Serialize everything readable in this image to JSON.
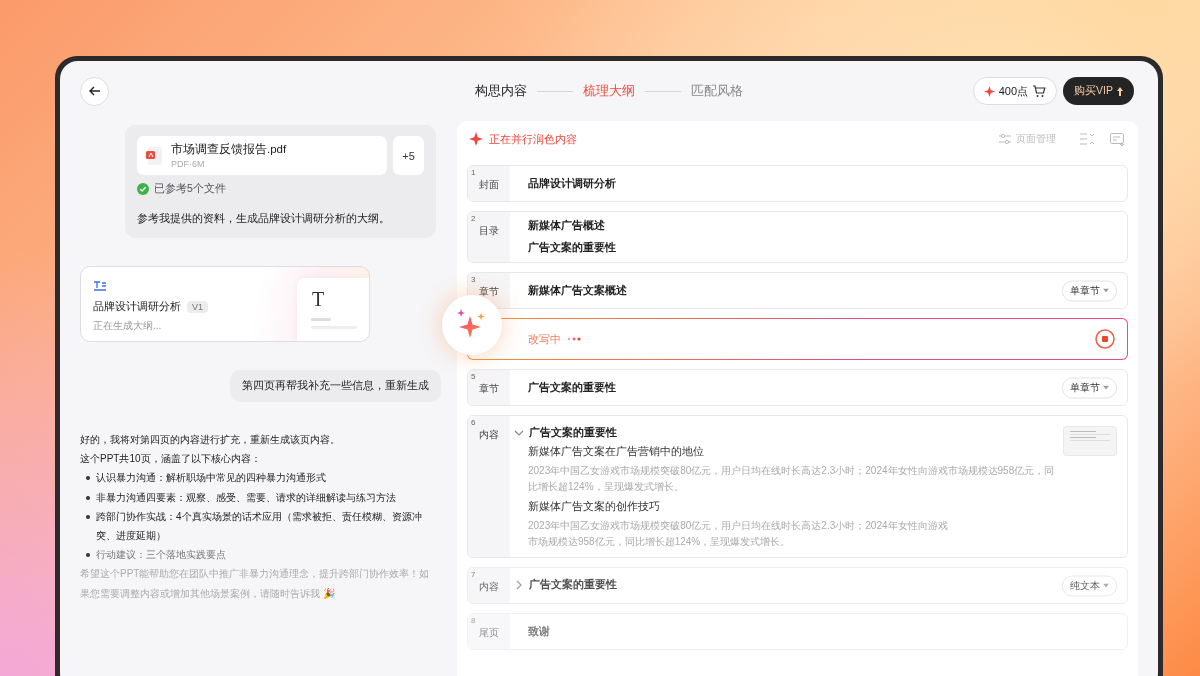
{
  "steps": [
    {
      "label": "构思内容",
      "selected": false,
      "done": true
    },
    {
      "label": "梳理大纲",
      "selected": true,
      "done": false
    },
    {
      "label": "匹配风格",
      "selected": false,
      "done": false
    }
  ],
  "points": "400点",
  "vip_button": "购买VIP",
  "chat": {
    "file": {
      "name": "市场调查反馈报告.pdf",
      "meta": "PDF·6M"
    },
    "more_files": "+5",
    "referenced": "已参考5个文件",
    "prompt": "参考我提供的资料，生成品牌设计调研分析的大纲。",
    "outline_card": {
      "title": "品牌设计调研分析",
      "version": "V1",
      "status": "正在生成大纲...",
      "preview_letter": "T"
    },
    "followup": "第四页再帮我补充一些信息，重新生成",
    "reply": {
      "lines": [
        "好的，我将对第四页的内容进行扩充，重新生成该页内容。",
        "这个PPT共10页，涵盖了以下核心内容："
      ],
      "bullets": [
        "认识暴力沟通：解析职场中常见的四种暴力沟通形式",
        "非暴力沟通四要素：观察、感受、需要、请求的详细解读与练习方法",
        "跨部门协作实战：4个真实场景的话术应用（需求被拒、责任模糊、资源冲突、进度延期）",
        "行动建议：三个落地实践要点"
      ],
      "closing": "希望这个PPT能帮助您在团队中推广非暴力沟通理念，提升跨部门协作效率！如果您需要调整内容或增加其他场景案例，请随时告诉我 🎉"
    }
  },
  "outline": {
    "status": "正在并行润色内容",
    "page_manage": "页面管理",
    "pages": [
      {
        "kind": "title",
        "number": "1",
        "type": "封面",
        "titles": [
          "品牌设计调研分析"
        ]
      },
      {
        "kind": "list",
        "number": "2",
        "type": "目录",
        "titles": [
          "新媒体广告概述",
          "广告文案的重要性"
        ]
      },
      {
        "kind": "title",
        "number": "3",
        "type": "章节",
        "titles": [
          "新媒体广告文案概述"
        ],
        "layout": "单章节"
      },
      {
        "kind": "rewriting",
        "status": "改写中"
      },
      {
        "kind": "title",
        "number": "5",
        "type": "章节",
        "titles": [
          "广告文案的重要性"
        ],
        "layout": "单章节"
      },
      {
        "kind": "content",
        "number": "6",
        "type": "内容",
        "expanded": true,
        "titles": [
          "广告文案的重要性"
        ],
        "sections": [
          {
            "heading": "新媒体广告文案在广告营销中的地位",
            "body": "2023年中国乙女游戏市场规模突破80亿元，用户日均在线时长高达2.3小时；2024年女性向游戏市场规模达958亿元，同比增长超124%，呈现爆发式增长。"
          },
          {
            "heading": "新媒体广告文案的创作技巧",
            "body": "2023年中国乙女游戏市场规模突破80亿元，用户日均在线时长高达2.3小时；2024年女性向游戏市场规模达958亿元，同比增长超124%，呈现爆发式增长。"
          }
        ]
      },
      {
        "kind": "content",
        "number": "7",
        "type": "内容",
        "expanded": false,
        "titles": [
          "广告文案的重要性"
        ],
        "layout": "纯文本"
      },
      {
        "kind": "title",
        "number": "8",
        "type": "尾页",
        "titles": [
          "致谢"
        ]
      }
    ]
  }
}
